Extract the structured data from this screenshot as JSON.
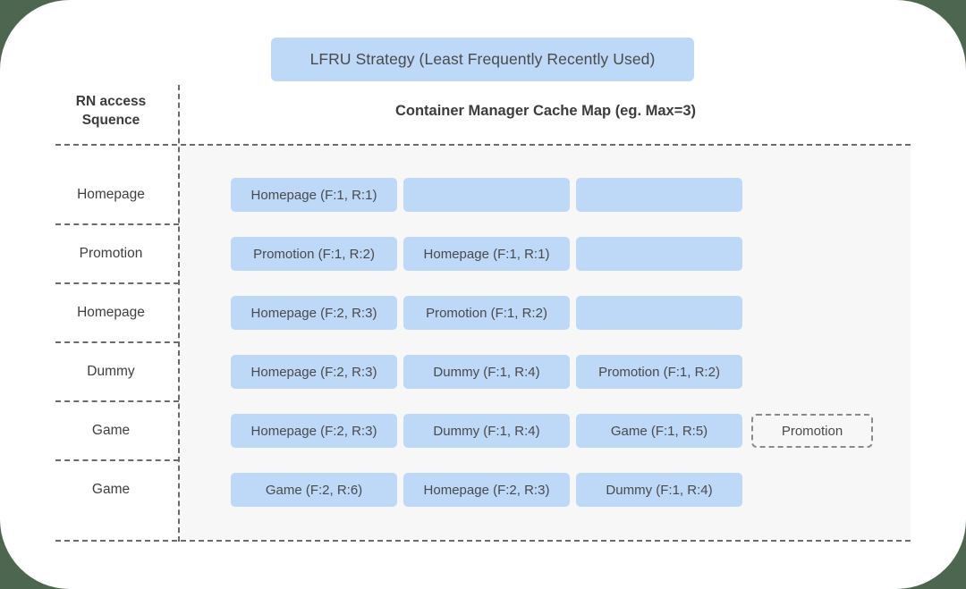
{
  "title_banner": {
    "label": "LFRU Strategy (Least Frequently Recently Used)",
    "background": "#bed8f7"
  },
  "headers": {
    "left_column": "RN access\nSquence",
    "left_column_line1": "RN access",
    "left_column_line2": "Squence",
    "right_column": "Container Manager Cache Map (eg. Max=3)"
  },
  "colors": {
    "page_background": "#4c6650",
    "card_background": "#ffffff",
    "panel_background": "#f7f7f7",
    "cell_blue": "#bed8f7",
    "dash_gray": "#6b6b6b",
    "text": "#4a4a4a"
  },
  "cache_max": 3,
  "rows": [
    {
      "access": "Homepage",
      "slots": [
        "Homepage (F:1, R:1)",
        "",
        ""
      ],
      "evicted": ""
    },
    {
      "access": "Promotion",
      "slots": [
        "Promotion (F:1, R:2)",
        "Homepage (F:1, R:1)",
        ""
      ],
      "evicted": ""
    },
    {
      "access": "Homepage",
      "slots": [
        "Homepage (F:2, R:3)",
        "Promotion (F:1, R:2)",
        ""
      ],
      "evicted": ""
    },
    {
      "access": "Dummy",
      "slots": [
        "Homepage (F:2, R:3)",
        "Dummy (F:1, R:4)",
        "Promotion (F:1, R:2)"
      ],
      "evicted": ""
    },
    {
      "access": "Game",
      "slots": [
        "Homepage (F:2, R:3)",
        "Dummy (F:1, R:4)",
        "Game (F:1, R:5)"
      ],
      "evicted": "Promotion"
    },
    {
      "access": "Game",
      "slots": [
        "Game (F:2, R:6)",
        "Homepage (F:2, R:3)",
        "Dummy (F:1, R:4)"
      ],
      "evicted": ""
    }
  ]
}
